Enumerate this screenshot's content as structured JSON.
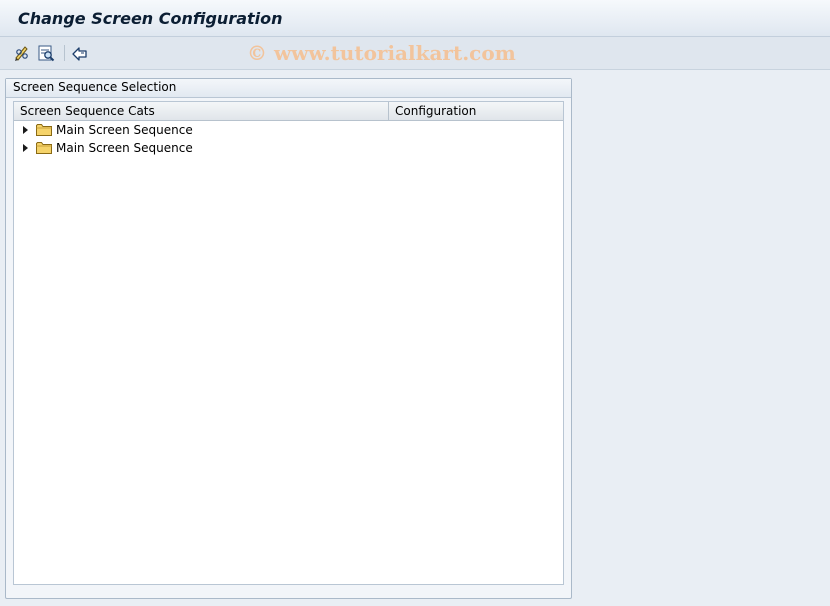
{
  "window": {
    "title": "Change Screen Configuration"
  },
  "toolbar": {
    "buttons": [
      {
        "icon": "pencil-glasses-icon",
        "tooltip": ""
      },
      {
        "icon": "where-used-list-icon",
        "tooltip": ""
      },
      {
        "icon": "cross-application-icon",
        "tooltip": ""
      }
    ]
  },
  "watermark": {
    "text": "© www.tutorialkart.com"
  },
  "panel": {
    "title": "Screen Sequence Selection",
    "tree": {
      "columns": [
        "Screen Sequence Cats",
        "Configuration"
      ],
      "rows": [
        {
          "label": "Main Screen Sequence",
          "icon": "folder-icon",
          "expanded": false,
          "configuration": ""
        },
        {
          "label": "Main Screen Sequence",
          "icon": "folder-icon",
          "expanded": false,
          "configuration": ""
        }
      ]
    }
  },
  "colors": {
    "background": "#e9eef4",
    "panel_border": "#aab9c9",
    "folder_fill": "#f5d36a"
  }
}
